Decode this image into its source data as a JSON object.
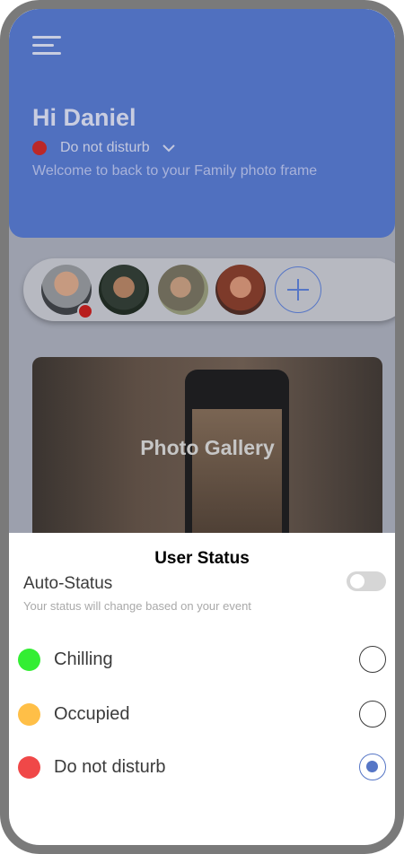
{
  "header": {
    "greeting": "Hi Daniel",
    "status_label": "Do not disturb",
    "welcome": "Welcome to back to your Family photo frame"
  },
  "gallery": {
    "title": "Photo Gallery"
  },
  "sheet": {
    "title": "User Status",
    "auto_status_label": "Auto-Status",
    "auto_status_hint": "Your status will change based on your event",
    "auto_status_enabled": false,
    "options": [
      {
        "label": "Chilling",
        "color": "#33ee33",
        "selected": false
      },
      {
        "label": "Occupied",
        "color": "#ffbf47",
        "selected": false
      },
      {
        "label": "Do not disturb",
        "color": "#f04848",
        "selected": true
      }
    ]
  },
  "colors": {
    "header_bg": "#5070bf",
    "accent": "#5676c6"
  }
}
